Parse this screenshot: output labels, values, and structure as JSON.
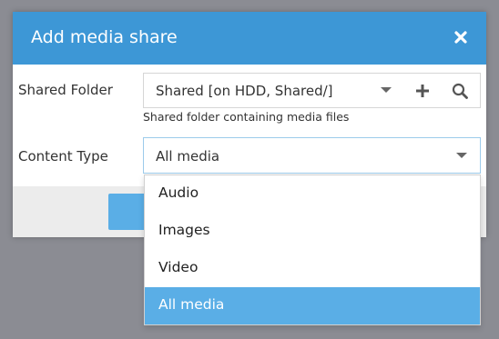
{
  "dialog": {
    "title": "Add media share",
    "close_icon": "close-icon"
  },
  "shared_folder": {
    "label": "Shared Folder",
    "value": "Shared [on HDD, Shared/]",
    "hint": "Shared folder containing media files",
    "icons": [
      "chevron-down-icon",
      "plus-icon",
      "search-icon"
    ]
  },
  "content_type": {
    "label": "Content Type",
    "value": "All media",
    "options": [
      "Audio",
      "Images",
      "Video",
      "All media"
    ],
    "selected": "All media"
  },
  "colors": {
    "accent": "#3d97d6",
    "selected": "#5aaee6",
    "overlay": "#8b8c93"
  }
}
